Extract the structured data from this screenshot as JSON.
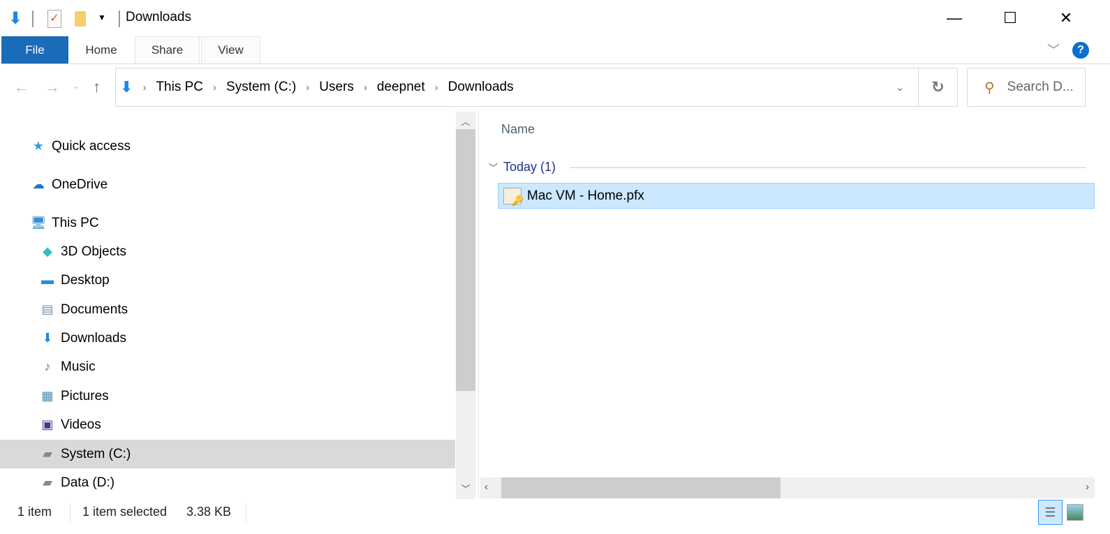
{
  "window": {
    "title": "Downloads",
    "minimize": "—",
    "maximize": "☐",
    "close": "✕"
  },
  "ribbon": {
    "tabs": [
      "File",
      "Home",
      "Share",
      "View"
    ],
    "help": "?"
  },
  "address": {
    "crumbs": [
      "This PC",
      "System (C:)",
      "Users",
      "deepnet",
      "Downloads"
    ],
    "search_placeholder": "Search D..."
  },
  "nav": [
    {
      "label": "Quick access",
      "icon": "star-icon"
    },
    {
      "label": "OneDrive",
      "icon": "cloud-icon"
    },
    {
      "label": "This PC",
      "icon": "computer-icon"
    },
    {
      "label": "3D Objects",
      "icon": "cube-icon"
    },
    {
      "label": "Desktop",
      "icon": "desktop-icon"
    },
    {
      "label": "Documents",
      "icon": "document-icon"
    },
    {
      "label": "Downloads",
      "icon": "download-icon"
    },
    {
      "label": "Music",
      "icon": "music-icon"
    },
    {
      "label": "Pictures",
      "icon": "pictures-icon"
    },
    {
      "label": "Videos",
      "icon": "videos-icon"
    },
    {
      "label": "System (C:)",
      "icon": "drive-icon"
    },
    {
      "label": "Data (D:)",
      "icon": "drive-icon"
    }
  ],
  "content": {
    "column_name": "Name",
    "group": "Today (1)",
    "files": [
      {
        "name": "Mac VM - Home.pfx",
        "icon": "certificate-icon"
      }
    ]
  },
  "status": {
    "count": "1 item",
    "selected": "1 item selected",
    "size": "3.38 KB"
  }
}
